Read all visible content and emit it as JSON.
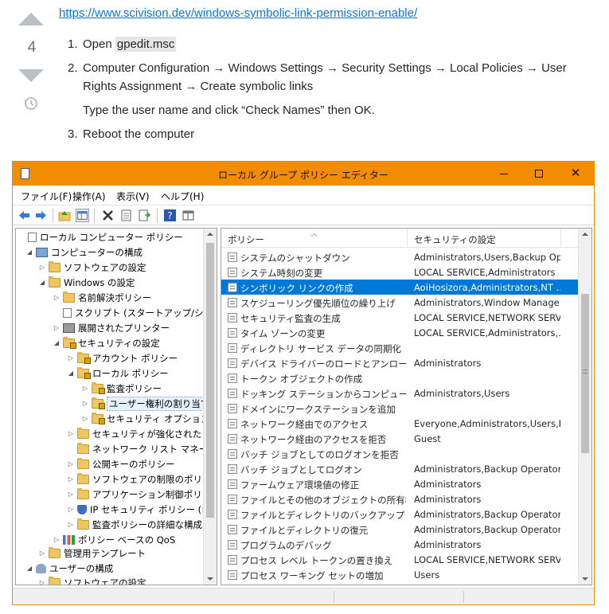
{
  "answer": {
    "vote_count": "4",
    "link": "https://www.scivision.dev/windows-symbolic-link-permission-enable/",
    "steps": [
      {
        "num": "1.",
        "before": "Open ",
        "code": "gpedit.msc"
      },
      {
        "num": "2.",
        "text": "Computer Configuration → Windows Settings → Security Settings → Local Policies → User Rights Assignment → Create symbolic links",
        "note": "Type the user name and click “Check Names” then OK."
      },
      {
        "num": "3.",
        "text": "Reboot the computer"
      }
    ]
  },
  "window": {
    "title": "ローカル グループ ポリシー エディター",
    "accent": "#f28c00",
    "menu": [
      "ファイル(F)",
      "操作(A)",
      "表示(V)",
      "ヘルプ(H)"
    ],
    "tree": [
      {
        "label": "ローカル コンピューター ポリシー",
        "icon": "doc-icon"
      },
      {
        "label": "コンピューターの構成",
        "icon": "computer-icon"
      },
      {
        "label": "ソフトウェアの設定",
        "icon": "folder-icon"
      },
      {
        "label": "Windows の設定",
        "icon": "folder-icon"
      },
      {
        "label": "名前解決ポリシー",
        "icon": "folder-icon"
      },
      {
        "label": "スクリプト (スタートアップ/シャットダ",
        "icon": "doc-icon"
      },
      {
        "label": "展開されたプリンター",
        "icon": "printer-icon"
      },
      {
        "label": "セキュリティの設定",
        "icon": "security-folder-icon"
      },
      {
        "label": "アカウント ポリシー",
        "icon": "security-folder-icon"
      },
      {
        "label": "ローカル ポリシー",
        "icon": "security-folder-icon"
      },
      {
        "label": "監査ポリシー",
        "icon": "security-folder-icon"
      },
      {
        "label": "ユーザー権利の割り当て",
        "icon": "security-folder-icon"
      },
      {
        "label": "セキュリティ オプション",
        "icon": "security-folder-icon"
      },
      {
        "label": "セキュリティが強化された Win",
        "icon": "folder-icon"
      },
      {
        "label": "ネットワーク リスト マネージャー",
        "icon": "folder-icon"
      },
      {
        "label": "公開キーのポリシー",
        "icon": "folder-icon"
      },
      {
        "label": "ソフトウェアの制限のポリシー",
        "icon": "folder-icon"
      },
      {
        "label": "アプリケーション制御ポリシー",
        "icon": "folder-icon"
      },
      {
        "label": "IP セキュリティ ポリシー (ローカ",
        "icon": "shield-icon"
      },
      {
        "label": "監査ポリシーの詳細な構成",
        "icon": "folder-icon"
      },
      {
        "label": "ポリシー ベースの QoS",
        "icon": "chart-icon"
      },
      {
        "label": "管理用テンプレート",
        "icon": "folder-icon"
      },
      {
        "label": "ユーザーの構成",
        "icon": "user-icon"
      },
      {
        "label": "ソフトウェアの設定",
        "icon": "folder-icon"
      }
    ],
    "columns": [
      "ポリシー",
      "セキュリティの設定"
    ],
    "policies": [
      {
        "policy": "システムのシャットダウン",
        "setting": "Administrators,Users,Backup Op..."
      },
      {
        "policy": "システム時刻の変更",
        "setting": "LOCAL SERVICE,Administrators"
      },
      {
        "policy": "シンボリック リンクの作成",
        "setting": "AoiHosizora,Administrators,NT ..."
      },
      {
        "policy": "スケジューリング優先順位の繰り上げ",
        "setting": "Administrators,Window Manage..."
      },
      {
        "policy": "セキュリティ監査の生成",
        "setting": "LOCAL SERVICE,NETWORK SERVI..."
      },
      {
        "policy": "タイム ゾーンの変更",
        "setting": "LOCAL SERVICE,Administrators,..."
      },
      {
        "policy": "ディレクトリ サービス データの同期化",
        "setting": ""
      },
      {
        "policy": "デバイス ドライバーのロードとアンロード",
        "setting": "Administrators"
      },
      {
        "policy": "トークン オブジェクトの作成",
        "setting": ""
      },
      {
        "policy": "ドッキング ステーションからコンピューターを削除",
        "setting": "Administrators,Users"
      },
      {
        "policy": "ドメインにワークステーションを追加",
        "setting": ""
      },
      {
        "policy": "ネットワーク経由でのアクセス",
        "setting": "Everyone,Administrators,Users,B..."
      },
      {
        "policy": "ネットワーク経由のアクセスを拒否",
        "setting": "Guest"
      },
      {
        "policy": "バッチ ジョブとしてのログオンを拒否",
        "setting": ""
      },
      {
        "policy": "バッチ ジョブとしてログオン",
        "setting": "Administrators,Backup Operator..."
      },
      {
        "policy": "ファームウェア環境値の修正",
        "setting": "Administrators"
      },
      {
        "policy": "ファイルとその他のオブジェクトの所有権の...",
        "setting": "Administrators"
      },
      {
        "policy": "ファイルとディレクトリのバックアップ",
        "setting": "Administrators,Backup Operators"
      },
      {
        "policy": "ファイルとディレクトリの復元",
        "setting": "Administrators,Backup Operators"
      },
      {
        "policy": "プログラムのデバッグ",
        "setting": "Administrators"
      },
      {
        "policy": "プロセス レベル トークンの置き換え",
        "setting": "LOCAL SERVICE,NETWORK SERVI..."
      },
      {
        "policy": "プロセス ワーキング セットの増加",
        "setting": "Users"
      }
    ]
  }
}
